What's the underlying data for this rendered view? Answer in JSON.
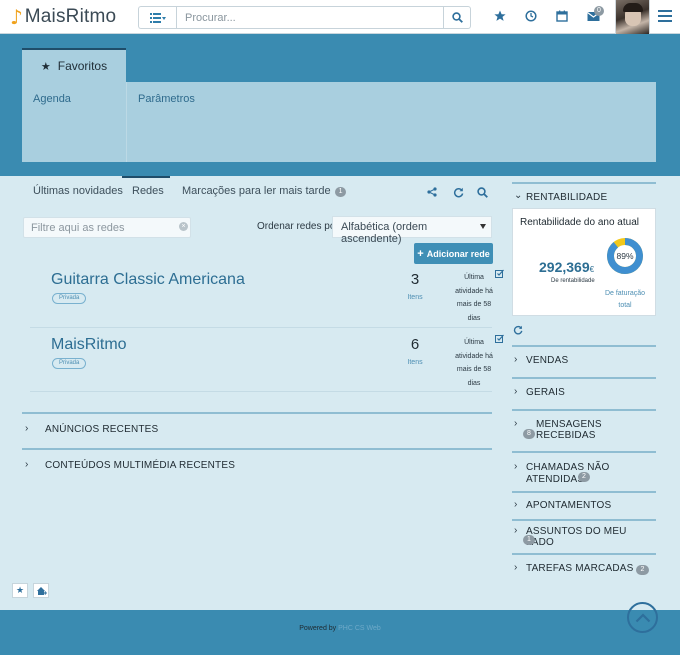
{
  "header": {
    "logo_text": "MaisRitmo",
    "search_placeholder": "Procurar...",
    "icons": [
      "star-icon",
      "clock-icon",
      "calendar-icon",
      "mail-icon"
    ],
    "mail_badge": "0"
  },
  "favorites": {
    "tab_label": "Favoritos",
    "links": [
      "Agenda",
      "Parâmetros"
    ]
  },
  "tabs": {
    "items": [
      {
        "label": "Últimas novidades"
      },
      {
        "label": "Redes"
      },
      {
        "label": "Marcações para ler mais tarde",
        "badge": "1"
      }
    ]
  },
  "filter": {
    "placeholder": "Filtre aqui as redes",
    "order_label": "Ordenar redes por:",
    "order_value": "Alfabética (ordem ascendente)",
    "add_button": "Adicionar rede"
  },
  "networks": [
    {
      "title": "Guitarra Classic Americana",
      "tag": "Privada",
      "count": "3",
      "items_label": "Itens",
      "activity": "Última atividade há mais de 58 dias"
    },
    {
      "title": "MaisRitmo",
      "tag": "Privada",
      "count": "6",
      "items_label": "Itens",
      "activity": "Última atividade há mais de 58 dias"
    }
  ],
  "left_sections": [
    {
      "label": "ANÚNCIOS RECENTES"
    },
    {
      "label": "CONTEÚDOS MULTIMÉDIA RECENTES"
    }
  ],
  "rentabilidade": {
    "header": "RENTABILIDADE",
    "card_title": "Rentabilidade do ano atual",
    "value": "292,369",
    "currency": "€",
    "value_label": "De rentabilidade",
    "percent": "89%",
    "percent_value": 0.89,
    "percent_label": "De faturação total"
  },
  "right_sections": [
    {
      "label": "VENDAS",
      "badge": ""
    },
    {
      "label": "GERAIS",
      "badge": ""
    },
    {
      "label": "MENSAGENS RECEBIDAS",
      "badge": "8"
    },
    {
      "label": "CHAMADAS NÃO ATENDIDAS",
      "badge": "2"
    },
    {
      "label": "APONTAMENTOS",
      "badge": ""
    },
    {
      "label": "ASSUNTOS DO MEU LADO",
      "badge": "1"
    },
    {
      "label": "TAREFAS MARCADAS",
      "badge": "2"
    }
  ],
  "footer": {
    "powered_by": "Powered by",
    "brand": "PHC CS Web"
  },
  "colors": {
    "accent": "#3a8bb1",
    "panel": "#a9cfdf",
    "background": "#d7eaf1",
    "donut_fill": "#3f8fd0",
    "donut_rest": "#f2c81a"
  }
}
